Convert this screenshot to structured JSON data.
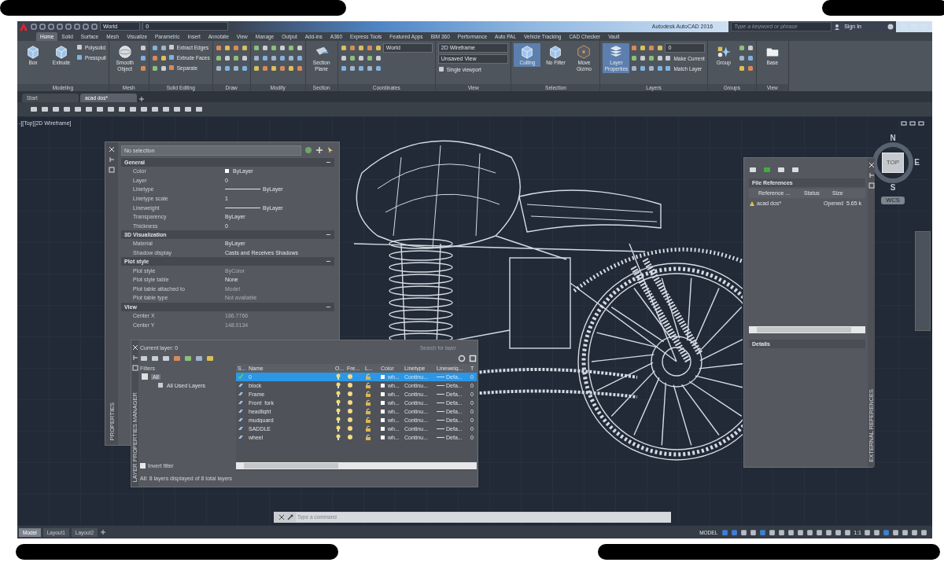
{
  "title_bar": {
    "workspace": "World",
    "layer": "0",
    "title": "Autodesk AutoCAD 2016",
    "search": {
      "placeholder": "Type a keyword or phrase"
    },
    "sign_in": "Sign In"
  },
  "ribbon_tabs": [
    {
      "label": "Home",
      "selected": true
    },
    {
      "label": "Solid",
      "selected": false
    },
    {
      "label": "Surface",
      "selected": false
    },
    {
      "label": "Mesh",
      "selected": false
    },
    {
      "label": "Visualize",
      "selected": false
    },
    {
      "label": "Parametric",
      "selected": false
    },
    {
      "label": "Insert",
      "selected": false
    },
    {
      "label": "Annotate",
      "selected": false
    },
    {
      "label": "View",
      "selected": false
    },
    {
      "label": "Manage",
      "selected": false
    },
    {
      "label": "Output",
      "selected": false
    },
    {
      "label": "Add-ins",
      "selected": false
    },
    {
      "label": "A360",
      "selected": false
    },
    {
      "label": "Express Tools",
      "selected": false
    },
    {
      "label": "Featured Apps",
      "selected": false
    },
    {
      "label": "BIM 360",
      "selected": false
    },
    {
      "label": "Performance",
      "selected": false
    },
    {
      "label": "Auto PAL",
      "selected": false
    },
    {
      "label": "Vehicle Tracking",
      "selected": false
    },
    {
      "label": "CAD Checker",
      "selected": false
    },
    {
      "label": "Vault",
      "selected": false
    }
  ],
  "ribbon_panels": [
    {
      "title": "Modeling",
      "large": [
        {
          "label": "Box",
          "on": false
        },
        {
          "label": "Extrude",
          "on": false
        }
      ],
      "small": [
        "Polysolid",
        "Presspull"
      ]
    },
    {
      "title": "Mesh",
      "large": [
        {
          "label": "Smooth Object",
          "on": false
        }
      ]
    },
    {
      "title": "Solid Editing",
      "small": [
        "Extract Edges",
        "Extrude Faces",
        "Separate"
      ]
    },
    {
      "title": "Draw"
    },
    {
      "title": "Modify"
    },
    {
      "title": "Section",
      "large": [
        {
          "label": "Section Plane",
          "on": false
        }
      ]
    },
    {
      "title": "Coordinates",
      "dropdowns": [
        "World"
      ]
    },
    {
      "title": "View",
      "dropdowns": [
        "2D Wireframe",
        "Unsaved View"
      ],
      "small": [
        "Single viewport"
      ]
    },
    {
      "title": "Selection",
      "large": [
        {
          "label": "Culling",
          "on": true
        },
        {
          "label": "No Filter",
          "on": false
        },
        {
          "label": "Move Gizmo",
          "on": false
        }
      ]
    },
    {
      "title": "Layers",
      "large": [
        {
          "label": "Layer Properties",
          "on": true
        }
      ],
      "dropdowns": [
        "0"
      ],
      "small": [
        "Make Current",
        "Match Layer"
      ]
    },
    {
      "title": "Groups",
      "large": [
        {
          "label": "Group",
          "on": false
        }
      ]
    },
    {
      "title": "View",
      "large": [
        {
          "label": "Base",
          "on": false
        }
      ]
    }
  ],
  "file_tabs": [
    {
      "label": "Start",
      "selected": false
    },
    {
      "label": "acad dos*",
      "selected": true
    }
  ],
  "viewport_label": "-][Top][2D Wireframe]",
  "viewcube": {
    "north": "N",
    "east": "E",
    "south": "S",
    "face": "TOP",
    "wcs": "WCS"
  },
  "properties": {
    "side_label": "PROPERTIES",
    "selection": "No selection",
    "sections": [
      {
        "title": "General",
        "expanded": true,
        "rows": [
          {
            "label": "Color",
            "value": "ByLayer",
            "kind": "swatch",
            "disabled": false
          },
          {
            "label": "Layer",
            "value": "0",
            "kind": "text",
            "disabled": false
          },
          {
            "label": "Linetype",
            "value": "ByLayer",
            "kind": "line",
            "disabled": false
          },
          {
            "label": "Linetype scale",
            "value": "1",
            "kind": "text",
            "disabled": false
          },
          {
            "label": "Lineweight",
            "value": "ByLayer",
            "kind": "line",
            "disabled": false
          },
          {
            "label": "Transparency",
            "value": "ByLayer",
            "kind": "text",
            "disabled": false
          },
          {
            "label": "Thickness",
            "value": "0",
            "kind": "text",
            "disabled": false
          }
        ]
      },
      {
        "title": "3D Visualization",
        "expanded": true,
        "rows": [
          {
            "label": "Material",
            "value": "ByLayer",
            "kind": "text",
            "disabled": false
          },
          {
            "label": "Shadow display",
            "value": "Casts and Receives Shadows",
            "kind": "text",
            "disabled": false
          }
        ]
      },
      {
        "title": "Plot style",
        "expanded": true,
        "rows": [
          {
            "label": "Plot style",
            "value": "ByColor",
            "kind": "text",
            "disabled": true
          },
          {
            "label": "Plot style table",
            "value": "None",
            "kind": "text",
            "disabled": false
          },
          {
            "label": "Plot table attached to",
            "value": "Model",
            "kind": "text",
            "disabled": true
          },
          {
            "label": "Plot table type",
            "value": "Not available",
            "kind": "text",
            "disabled": true
          }
        ]
      },
      {
        "title": "View",
        "expanded": true,
        "rows": [
          {
            "label": "Center X",
            "value": "186.7766",
            "kind": "text",
            "disabled": true
          },
          {
            "label": "Center Y",
            "value": "148.0134",
            "kind": "text",
            "disabled": true
          }
        ]
      }
    ]
  },
  "layer_manager": {
    "side_label": "LAYER PROPERTIES MANAGER",
    "current_layer": "Current layer: 0",
    "search": {
      "placeholder": "Search for layer"
    },
    "filters_title": "Filters",
    "filter_tree": [
      {
        "label": "All",
        "expanded": true,
        "children": [
          {
            "label": "All Used Layers"
          }
        ]
      }
    ],
    "invert_filter": {
      "label": "Invert filter",
      "checked": false
    },
    "columns": [
      "S...",
      "Name",
      "O...",
      "Fre...",
      "L...",
      "Color",
      "Linetype",
      "Lineweig...",
      "T"
    ],
    "rows": [
      {
        "name": "0",
        "color_name": "wh...",
        "linetype": "Continu...",
        "lineweight": "Defa...",
        "transparency": "0",
        "selected": true,
        "current": true
      },
      {
        "name": "block",
        "color_name": "wh...",
        "linetype": "Continu...",
        "lineweight": "Defa...",
        "transparency": "0",
        "selected": false,
        "current": false
      },
      {
        "name": "Frame",
        "color_name": "wh...",
        "linetype": "Continu...",
        "lineweight": "Defa...",
        "transparency": "0",
        "selected": false,
        "current": false
      },
      {
        "name": "Front_fork",
        "color_name": "wh...",
        "linetype": "Continu...",
        "lineweight": "Defa...",
        "transparency": "0",
        "selected": false,
        "current": false
      },
      {
        "name": "headlight",
        "color_name": "wh...",
        "linetype": "Continu...",
        "lineweight": "Defa...",
        "transparency": "0",
        "selected": false,
        "current": false
      },
      {
        "name": "mudguard",
        "color_name": "wh...",
        "linetype": "Continu...",
        "lineweight": "Defa...",
        "transparency": "0",
        "selected": false,
        "current": false
      },
      {
        "name": "SADDLE",
        "color_name": "wh...",
        "linetype": "Continu...",
        "lineweight": "Defa...",
        "transparency": "0",
        "selected": false,
        "current": false
      },
      {
        "name": "wheel",
        "color_name": "wh...",
        "linetype": "Continu...",
        "lineweight": "Defa...",
        "transparency": "0",
        "selected": false,
        "current": false
      }
    ],
    "status": "All: 8 layers displayed of 8 total layers"
  },
  "external_references": {
    "side_label": "EXTERNAL REFERENCES",
    "section": "File References",
    "columns": [
      "Reference ...",
      "Status",
      "Size"
    ],
    "rows": [
      {
        "reference": "acad dos*",
        "status": "Opened",
        "size": "5.65 k"
      }
    ],
    "details": "Details"
  },
  "command_line": {
    "placeholder": "Type a command"
  },
  "layout_tabs": [
    {
      "label": "Model",
      "selected": true
    },
    {
      "label": "Layout1",
      "selected": false
    },
    {
      "label": "Layout2",
      "selected": false
    }
  ],
  "status_bar": {
    "model": "MODEL",
    "scale": "1:1"
  }
}
